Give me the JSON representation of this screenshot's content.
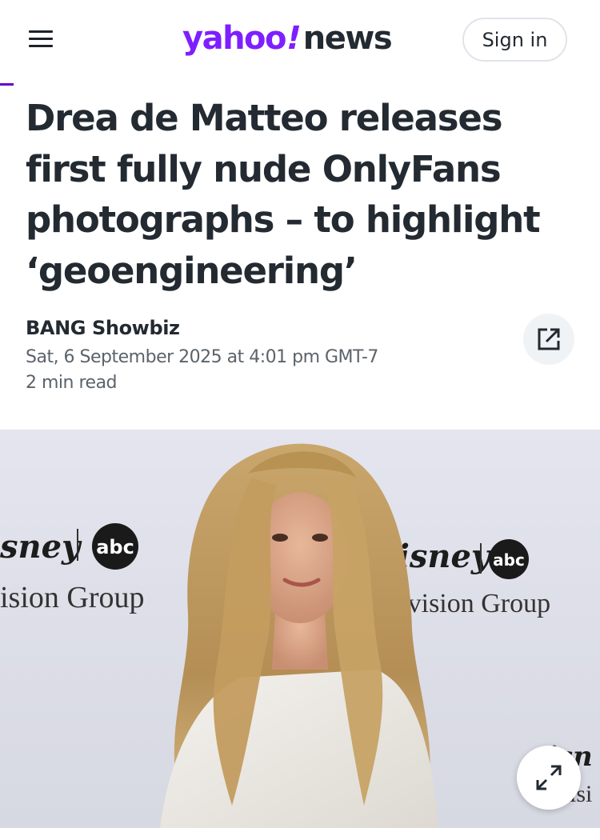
{
  "header": {
    "menu_icon": "hamburger-menu-icon",
    "logo_brand": "yahoo",
    "logo_bang": "!",
    "logo_section": "news",
    "signin_label": "Sign in",
    "brand_color": "#7e1fff"
  },
  "reading_progress": {
    "percent": 2.3,
    "color": "#6001d2"
  },
  "article": {
    "headline": "Drea de Matteo releases first fully nude OnlyFans photographs – to highlight ‘geoengineering’",
    "author": "BANG Showbiz",
    "date": "Sat, 6 September 2025 at 4:01 pm GMT-7",
    "read_time": "2 min read",
    "share_icon": "external-share-icon",
    "image": {
      "backdrop_left_logo": "sney",
      "backdrop_left_badge": "abc",
      "backdrop_left_text": "ision Group",
      "backdrop_right_logo": "Disney",
      "backdrop_right_badge": "abc",
      "backdrop_right_text": "elevision Group",
      "backdrop_edge_logo": "isn",
      "backdrop_edge_text": "isi",
      "expand_icon": "expand-arrows-icon"
    }
  }
}
